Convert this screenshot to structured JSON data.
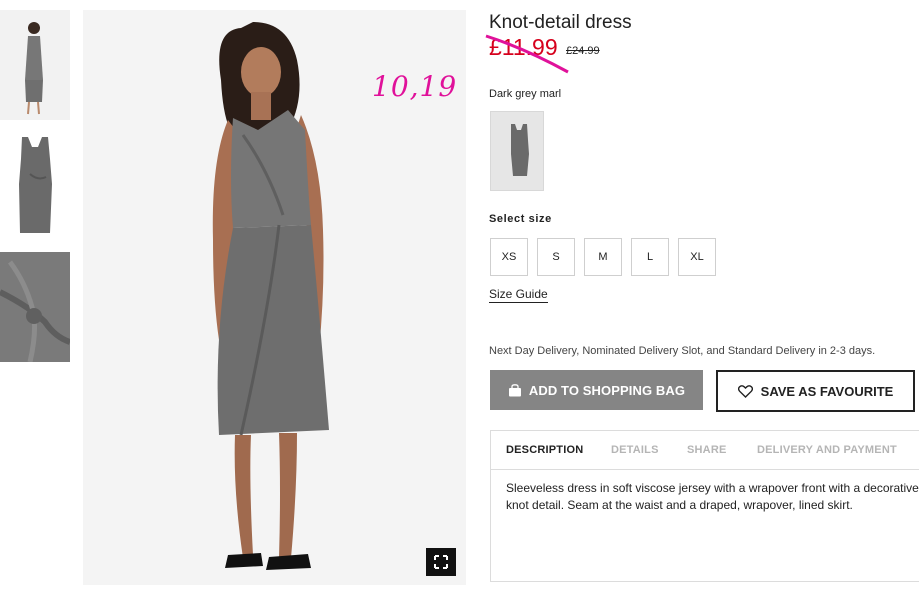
{
  "product": {
    "title": "Knot-detail dress",
    "price_new": "£11.99",
    "price_old": "£24.99",
    "handwritten_note": "10,19",
    "color_name": "Dark grey marl"
  },
  "size": {
    "heading": "Select size",
    "options": [
      "XS",
      "S",
      "M",
      "L",
      "XL"
    ],
    "guide_label": "Size Guide"
  },
  "delivery_note": "Next Day Delivery, Nominated Delivery Slot, and Standard Delivery in 2-3 days.",
  "actions": {
    "add_to_bag": "ADD TO SHOPPING BAG",
    "save_favourite": "SAVE AS FAVOURITE"
  },
  "tabs": {
    "items": [
      "DESCRIPTION",
      "DETAILS",
      "SHARE",
      "DELIVERY AND PAYMENT"
    ],
    "active": "DESCRIPTION"
  },
  "description": "Sleeveless dress in soft viscose jersey with a wrapover front with a decorative knot detail. Seam at the waist and a draped, wrapover, lined skirt.",
  "colors": {
    "price_red": "#d6001c",
    "annotation_pink": "#e0119a",
    "button_grey": "#858585",
    "dress_grey": "#6e6e6e"
  },
  "icons": {
    "bag": "shopping-bag-icon",
    "heart": "heart-icon",
    "expand": "expand-icon"
  }
}
